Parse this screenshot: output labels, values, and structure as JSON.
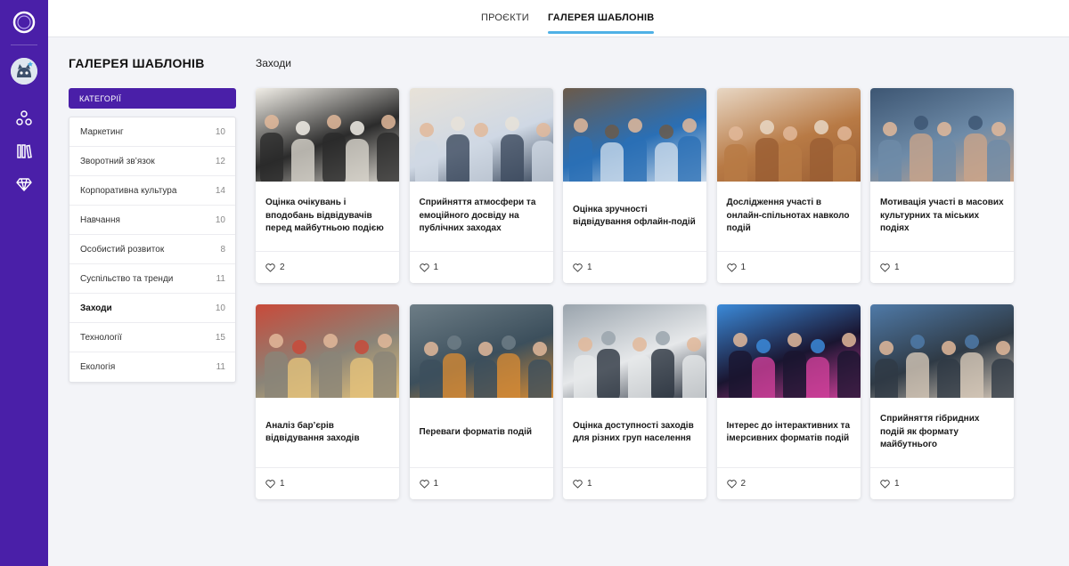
{
  "topbar": {
    "tabs": [
      {
        "label": "ПРОЄКТИ",
        "active": false
      },
      {
        "label": "ГАЛЕРЕЯ ШАБЛОНІВ",
        "active": true
      }
    ]
  },
  "sidebar": {
    "title": "ГАЛЕРЕЯ ШАБЛОНІВ",
    "categories_header": "КАТЕГОРІЇ",
    "categories": [
      {
        "label": "Маркетинг",
        "count": "10",
        "active": false
      },
      {
        "label": "Зворотний зв’язок",
        "count": "12",
        "active": false
      },
      {
        "label": "Корпоративна культура",
        "count": "14",
        "active": false
      },
      {
        "label": "Навчання",
        "count": "10",
        "active": false
      },
      {
        "label": "Особистий розвиток",
        "count": "8",
        "active": false
      },
      {
        "label": "Суспільство та тренди",
        "count": "11",
        "active": false
      },
      {
        "label": "Заходи",
        "count": "10",
        "active": true
      },
      {
        "label": "Технології",
        "count": "15",
        "active": false
      },
      {
        "label": "Екологія",
        "count": "11",
        "active": false
      }
    ]
  },
  "main": {
    "section_title": "Заходи",
    "cards": [
      {
        "title": "Оцінка очікувань і вподобань відвідувачів перед майбутньою подією",
        "likes": "2",
        "palette": [
          "#2b2b2b",
          "#d8d4cc",
          "#f2efe8"
        ]
      },
      {
        "title": "Сприйняття атмосфери та емоційного досвіду на публічних заходах",
        "likes": "1",
        "palette": [
          "#cfd8e4",
          "#3c4a5e",
          "#e8e2d8"
        ]
      },
      {
        "title": "Оцінка зручності відвідування офлайн-подій",
        "likes": "1",
        "palette": [
          "#2a6fb5",
          "#c9d9ea",
          "#6b5a4a"
        ]
      },
      {
        "title": "Дослідження участі в онлайн-спільнотах навколо подій",
        "likes": "1",
        "palette": [
          "#b87a45",
          "#9a5e33",
          "#e8d7c4"
        ]
      },
      {
        "title": "Мотивація участі в масових культурних та міських подіях",
        "likes": "1",
        "palette": [
          "#6e8ba8",
          "#c9a489",
          "#3d5673"
        ]
      },
      {
        "title": "Аналіз бар’єрів відвідування заходів",
        "likes": "1",
        "palette": [
          "#8a8478",
          "#e5c27a",
          "#c84a3a"
        ]
      },
      {
        "title": "Переваги форматів подій",
        "likes": "1",
        "palette": [
          "#3c4f5c",
          "#d48a34",
          "#6d7d86"
        ]
      },
      {
        "title": "Оцінка доступності заходів для різних груп населення",
        "likes": "1",
        "palette": [
          "#e6e8ea",
          "#2c3440",
          "#9aa4ad"
        ]
      },
      {
        "title": "Інтерес до інтерактивних та імерсивних форматів подій",
        "likes": "2",
        "palette": [
          "#1a1530",
          "#d0409a",
          "#3b8ad9"
        ]
      },
      {
        "title": "Сприйняття гібридних подій як формату майбутнього",
        "likes": "1",
        "palette": [
          "#2f3a45",
          "#d6c8b8",
          "#4f7aa8"
        ]
      }
    ]
  },
  "colors": {
    "brand": "#4a1fa8",
    "tab_underline": "#4fb1e6",
    "background": "#f3f4f8"
  },
  "icons": {
    "rail": [
      "app-logo-icon",
      "avatar",
      "nodes-icon",
      "library-icon",
      "diamond-icon"
    ],
    "like": "heart-icon"
  }
}
